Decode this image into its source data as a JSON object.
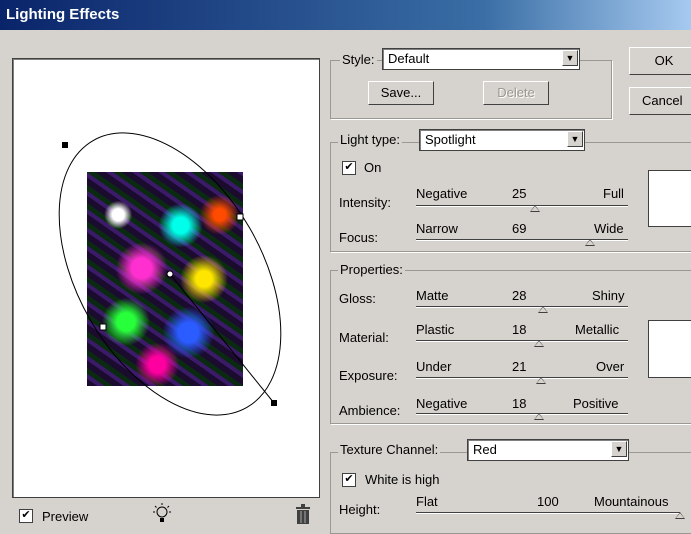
{
  "window": {
    "title": "Lighting Effects"
  },
  "style": {
    "label": "Style:",
    "value": "Default",
    "save": "Save...",
    "delete": "Delete"
  },
  "buttons": {
    "ok": "OK",
    "cancel": "Cancel"
  },
  "light": {
    "type_label": "Light type:",
    "type_value": "Spotlight",
    "on_label": "On",
    "on_checked": true,
    "intensity": {
      "label": "Intensity:",
      "left": "Negative",
      "value": "25",
      "right": "Full",
      "fraction": 0.56
    },
    "focus": {
      "label": "Focus:",
      "left": "Narrow",
      "value": "69",
      "right": "Wide",
      "fraction": 0.82
    }
  },
  "properties": {
    "label": "Properties:",
    "gloss": {
      "label": "Gloss:",
      "left": "Matte",
      "value": "28",
      "right": "Shiny",
      "fraction": 0.6
    },
    "material": {
      "label": "Material:",
      "left": "Plastic",
      "value": "18",
      "right": "Metallic",
      "fraction": 0.58
    },
    "exposure": {
      "label": "Exposure:",
      "left": "Under",
      "value": "21",
      "right": "Over",
      "fraction": 0.59
    },
    "ambience": {
      "label": "Ambience:",
      "left": "Negative",
      "value": "18",
      "right": "Positive",
      "fraction": 0.58
    }
  },
  "texture": {
    "label": "Texture Channel:",
    "value": "Red",
    "white_high_label": "White is high",
    "white_high_checked": true,
    "height": {
      "label": "Height:",
      "left": "Flat",
      "value": "100",
      "right": "Mountainous",
      "fraction": 1.0
    }
  },
  "preview": {
    "label": "Preview",
    "checked": true
  },
  "icons": {
    "light_bulb": "light-bulb-icon",
    "trash": "trash-icon",
    "check": "✔"
  }
}
